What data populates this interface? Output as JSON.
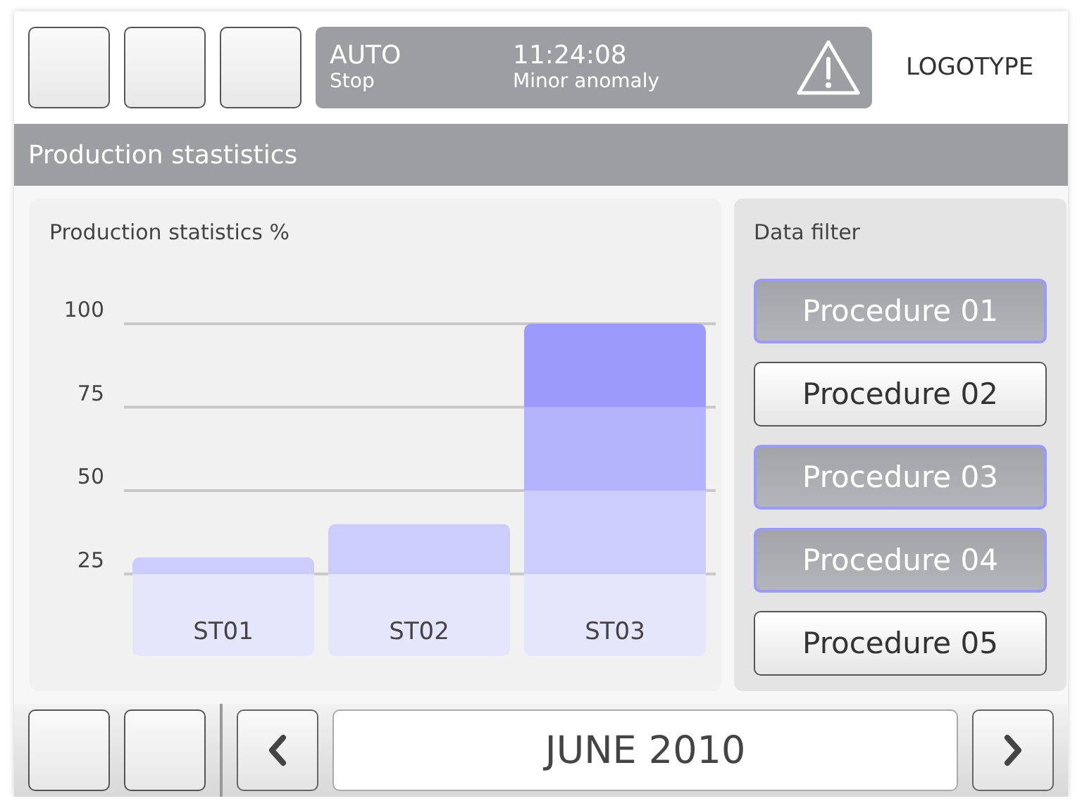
{
  "header": {
    "status": {
      "mode": "AUTO",
      "state": "Stop",
      "time": "11:24:08",
      "message": "Minor anomaly"
    },
    "logo": "LOGOTYPE"
  },
  "title_bar": {
    "title": "Production stastistics"
  },
  "chart_panel": {
    "title": "Production statistics %",
    "chart_data": {
      "type": "bar",
      "stacked": true,
      "categories": [
        "ST01",
        "ST02",
        "ST03"
      ],
      "ylim": [
        0,
        100
      ],
      "yticks": [
        25,
        50,
        75,
        100
      ],
      "grid": true,
      "series": [
        {
          "color": "#e5e5fc",
          "values": [
            25,
            25,
            25
          ]
        },
        {
          "color": "#ccccfd",
          "values": [
            5,
            15,
            25
          ]
        },
        {
          "color": "#b4b4fc",
          "values": [
            0,
            0,
            25
          ]
        },
        {
          "color": "#9b9bfc",
          "values": [
            0,
            0,
            25
          ]
        }
      ]
    }
  },
  "filter_panel": {
    "title": "Data filter",
    "items": [
      {
        "label": "Procedure 01",
        "selected": true
      },
      {
        "label": "Procedure 02",
        "selected": false
      },
      {
        "label": "Procedure 03",
        "selected": true
      },
      {
        "label": "Procedure 04",
        "selected": true
      },
      {
        "label": "Procedure 05",
        "selected": false
      }
    ]
  },
  "footer": {
    "period": "JUNE 2010"
  }
}
